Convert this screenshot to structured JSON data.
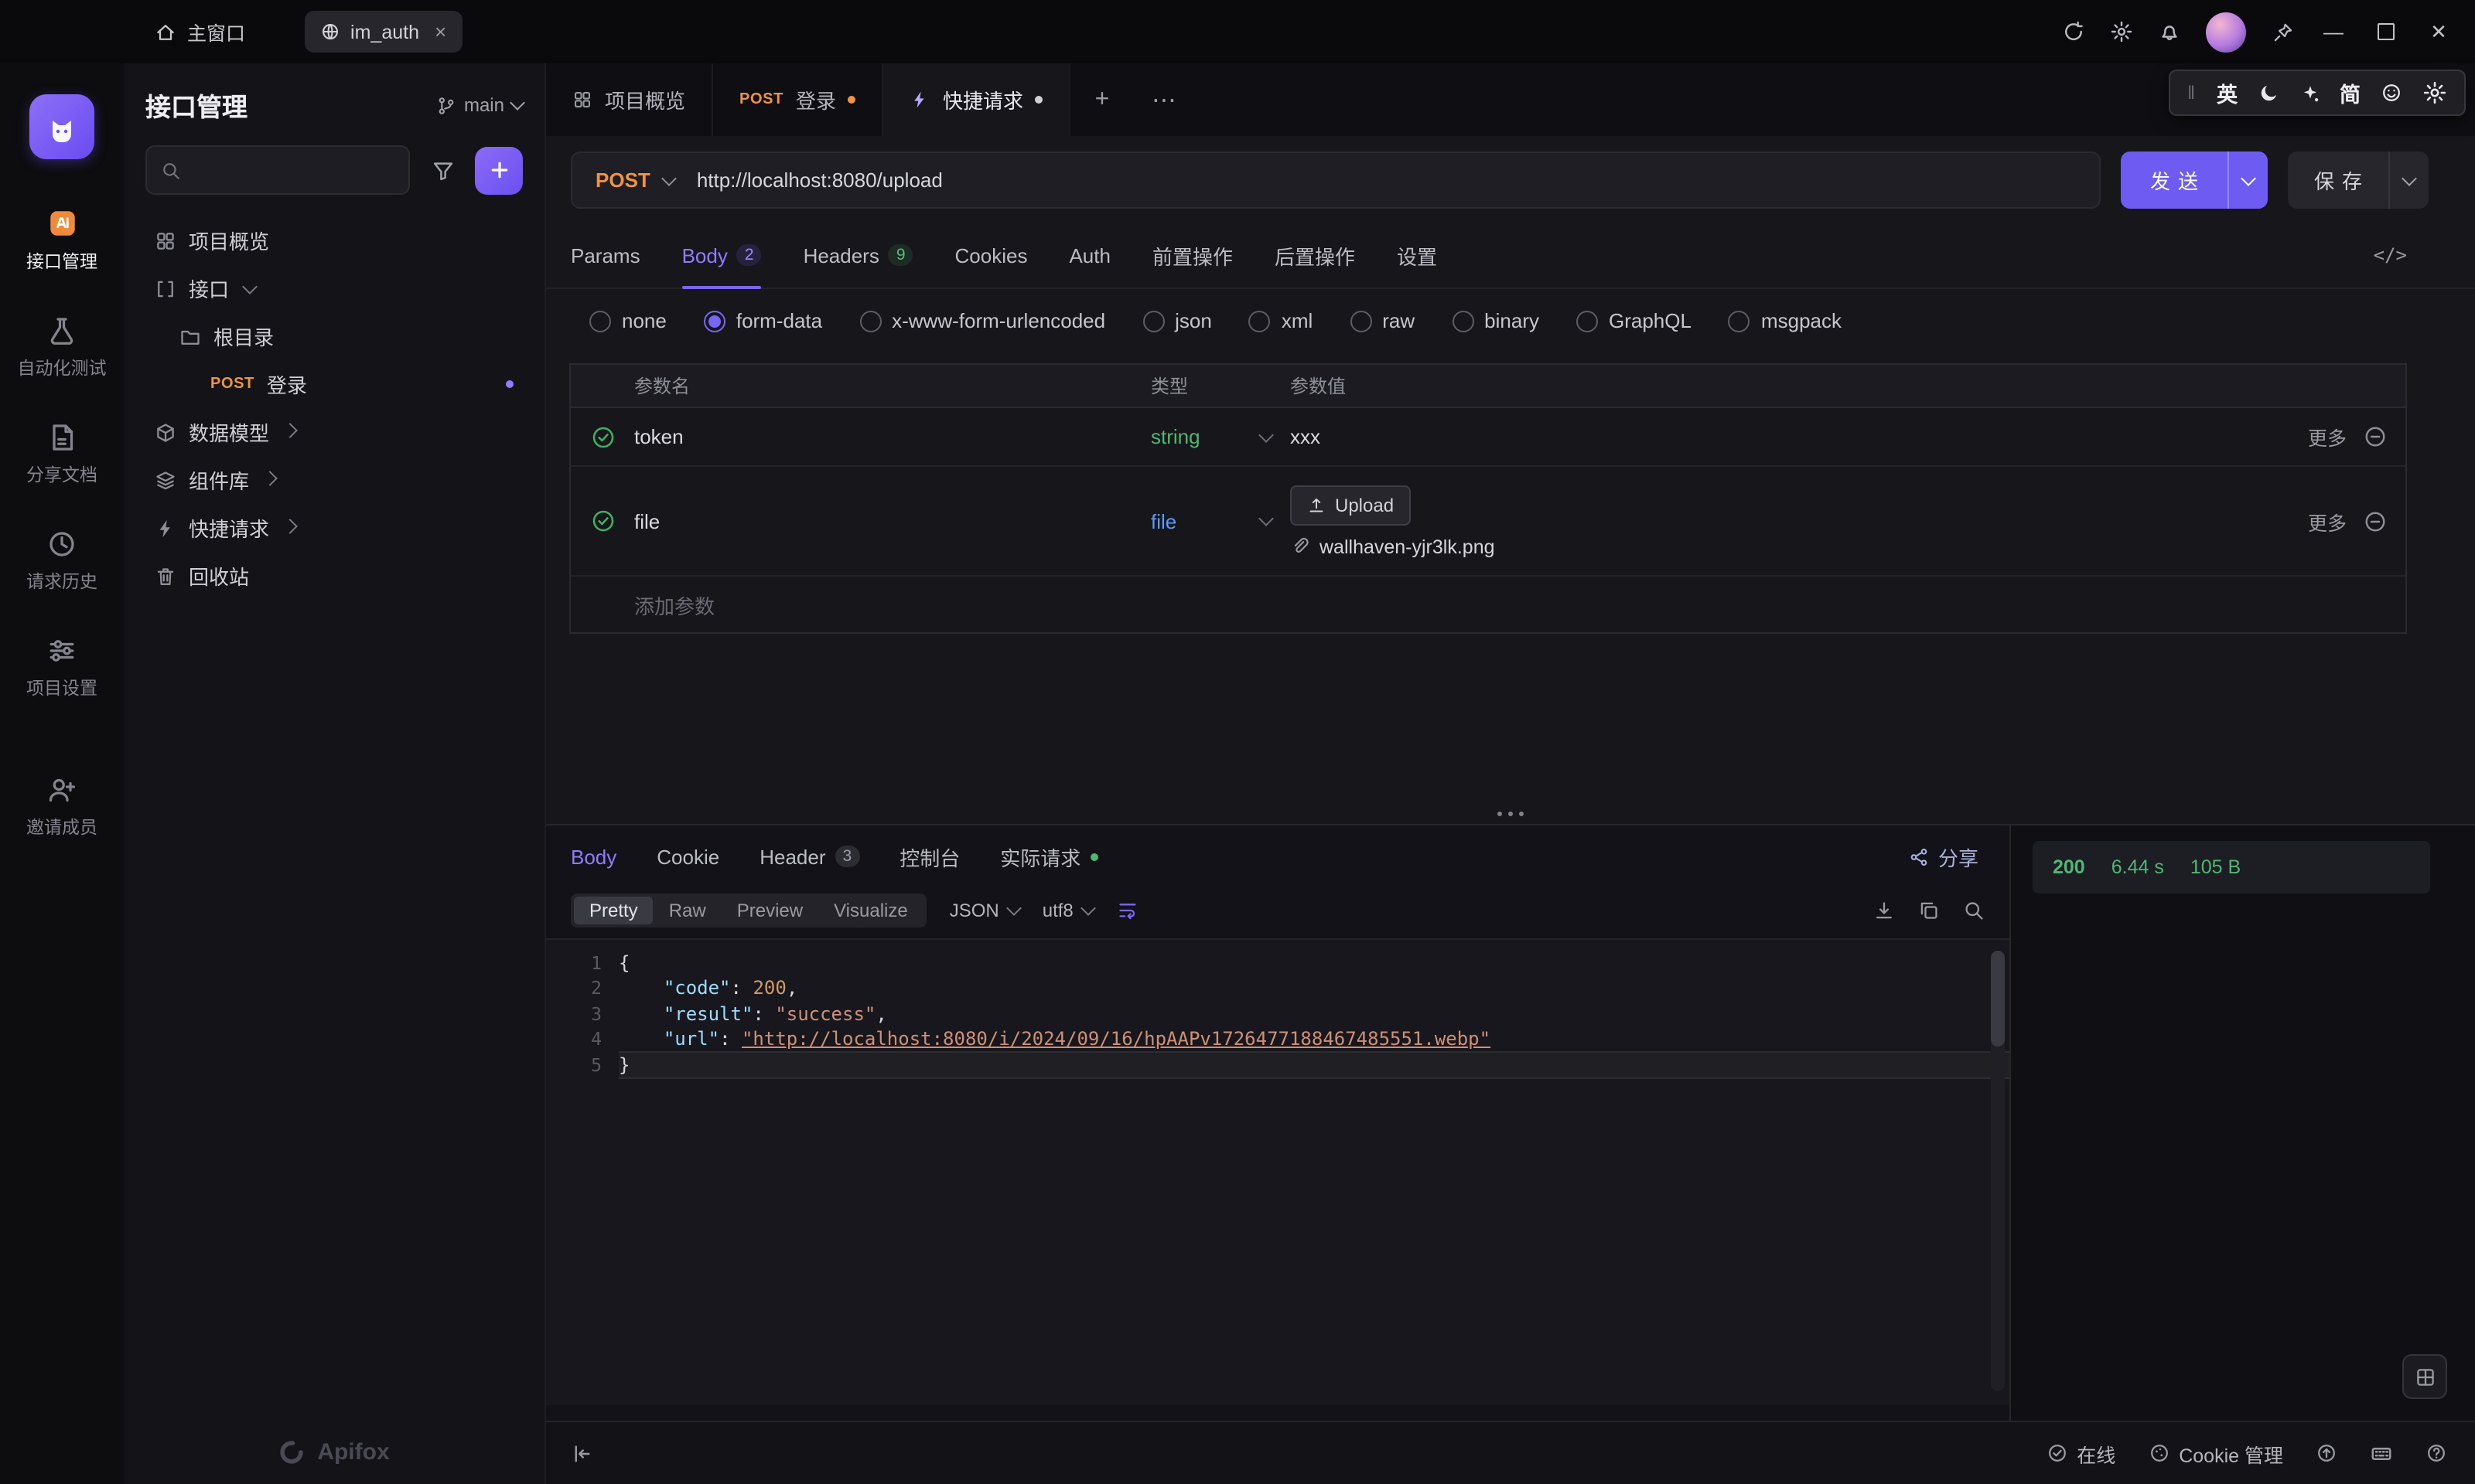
{
  "titlebar": {
    "home": "主窗口",
    "tab_label": "im_auth"
  },
  "ime": {
    "en": "英",
    "simp": "简"
  },
  "rail": {
    "items": [
      {
        "label": "接口管理"
      },
      {
        "label": "自动化测试"
      },
      {
        "label": "分享文档"
      },
      {
        "label": "请求历史"
      },
      {
        "label": "项目设置"
      },
      {
        "label": "邀请成员"
      }
    ]
  },
  "sidebar": {
    "title": "接口管理",
    "branch": "main",
    "items": {
      "overview": "项目概览",
      "api": "接口",
      "root_dir": "根目录",
      "login_method": "POST",
      "login_label": "登录",
      "models": "数据模型",
      "components": "组件库",
      "quick_request": "快捷请求",
      "recycle": "回收站"
    },
    "footer_logo": "Apifox"
  },
  "doc_tabs": {
    "tab1": "项目概览",
    "tab2_method": "POST",
    "tab2_label": "登录",
    "tab3": "快捷请求"
  },
  "request": {
    "method": "POST",
    "url": "http://localhost:8080/upload",
    "send": "发送",
    "save": "保存"
  },
  "req_tabs": {
    "params": "Params",
    "body": "Body",
    "body_count": "2",
    "headers": "Headers",
    "headers_count": "9",
    "cookies": "Cookies",
    "auth": "Auth",
    "pre_ops": "前置操作",
    "post_ops": "后置操作",
    "settings": "设置"
  },
  "body_types": {
    "options": [
      "none",
      "form-data",
      "x-www-form-urlencoded",
      "json",
      "xml",
      "raw",
      "binary",
      "GraphQL",
      "msgpack"
    ],
    "selected": "form-data"
  },
  "param_table": {
    "headers": {
      "name": "参数名",
      "type": "类型",
      "value": "参数值"
    },
    "more": "更多",
    "rows": [
      {
        "name": "token",
        "type": "string",
        "value": "xxx"
      },
      {
        "name": "file",
        "type": "file",
        "upload_label": "Upload",
        "filename": "wallhaven-yjr3lk.png"
      }
    ],
    "add": "添加参数"
  },
  "response": {
    "tabs": {
      "body": "Body",
      "cookie": "Cookie",
      "header": "Header",
      "header_count": "3",
      "console": "控制台",
      "actual": "实际请求"
    },
    "share": "分享",
    "views": [
      "Pretty",
      "Raw",
      "Preview",
      "Visualize"
    ],
    "selected_view": "Pretty",
    "format": "JSON",
    "encoding": "utf8",
    "status": {
      "code": "200",
      "time": "6.44 s",
      "size": "105 B"
    },
    "code_lines": [
      {
        "tokens": [
          {
            "c": "pun",
            "t": "{"
          }
        ]
      },
      {
        "tokens": [
          {
            "c": "pun",
            "t": "    "
          },
          {
            "c": "key",
            "t": "\"code\""
          },
          {
            "c": "pun",
            "t": ": "
          },
          {
            "c": "num",
            "t": "200"
          },
          {
            "c": "pun",
            "t": ","
          }
        ]
      },
      {
        "tokens": [
          {
            "c": "pun",
            "t": "    "
          },
          {
            "c": "key",
            "t": "\"result\""
          },
          {
            "c": "pun",
            "t": ": "
          },
          {
            "c": "str",
            "t": "\"success\""
          },
          {
            "c": "pun",
            "t": ","
          }
        ]
      },
      {
        "tokens": [
          {
            "c": "pun",
            "t": "    "
          },
          {
            "c": "key",
            "t": "\"url\""
          },
          {
            "c": "pun",
            "t": ": "
          },
          {
            "c": "strlink",
            "t": "\"http://localhost:8080/i/2024/09/16/hpAAPv1726477188467485551.webp\""
          }
        ]
      },
      {
        "active": true,
        "tokens": [
          {
            "c": "pun",
            "t": "}"
          }
        ]
      }
    ]
  },
  "statusbar": {
    "online": "在线",
    "cookie": "Cookie 管理"
  }
}
